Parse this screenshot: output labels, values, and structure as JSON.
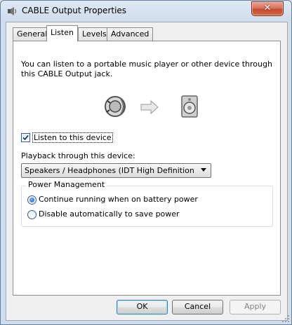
{
  "window": {
    "title": "CABLE Output Properties",
    "close_symbol": "✕"
  },
  "tabs": [
    {
      "label": "General",
      "active": false
    },
    {
      "label": "Listen",
      "active": true
    },
    {
      "label": "Levels",
      "active": false
    },
    {
      "label": "Advanced",
      "active": false
    }
  ],
  "listen": {
    "description": "You can listen to a portable music player or other device through this CABLE Output jack.",
    "listen_checkbox": {
      "label": "Listen to this device",
      "checked": true
    },
    "playback_label": "Playback through this device:",
    "playback_select": {
      "value": "Speakers / Headphones (IDT High Definition Audio"
    },
    "power": {
      "legend": "Power Management",
      "options": [
        {
          "label": "Continue running when on battery power",
          "selected": true
        },
        {
          "label": "Disable automatically to save power",
          "selected": false
        }
      ]
    },
    "icons": {
      "source": "speaker-device-icon",
      "arrow": "right-arrow-icon",
      "target": "speaker-device-icon"
    }
  },
  "buttons": {
    "ok": "OK",
    "cancel": "Cancel",
    "apply": "Apply"
  },
  "colors": {
    "close_button": "#c44a33",
    "accent": "#3c7fb1"
  }
}
